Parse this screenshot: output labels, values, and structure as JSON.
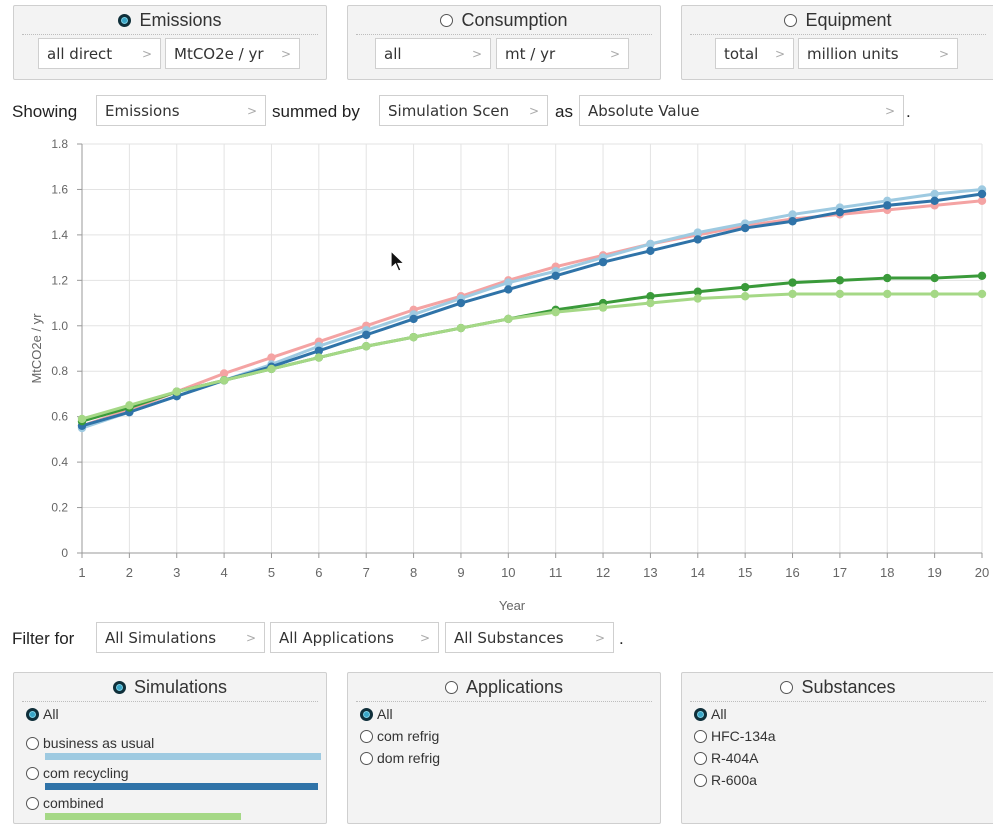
{
  "top_panels": [
    {
      "label": "Emissions",
      "selected": true,
      "dropdowns": [
        "all direct",
        "MtCO2e / yr"
      ]
    },
    {
      "label": "Consumption",
      "selected": false,
      "dropdowns": [
        "all",
        "mt / yr"
      ]
    },
    {
      "label": "Equipment",
      "selected": false,
      "dropdowns": [
        "total",
        "million units"
      ]
    }
  ],
  "showing": {
    "prefix": "Showing",
    "metric": "Emissions",
    "summed_by_label": "summed by",
    "group": "Simulation Scen",
    "as_label": "as",
    "mode": "Absolute Value",
    "period": "."
  },
  "filter": {
    "prefix": "Filter for",
    "simulations": "All Simulations",
    "applications": "All Applications",
    "substances": "All Substances",
    "period": "."
  },
  "bottom_panels": {
    "simulations": {
      "title": "Simulations",
      "selected": true,
      "items": [
        {
          "label": "All",
          "selected": true
        },
        {
          "label": "business as usual",
          "selected": false,
          "color": "#9ecae1",
          "bar_fraction": 1.0
        },
        {
          "label": "com recycling",
          "selected": false,
          "color": "#2f73a8",
          "bar_fraction": 0.99
        },
        {
          "label": "combined",
          "selected": false,
          "color": "#a5d886",
          "bar_fraction": 0.71
        }
      ]
    },
    "applications": {
      "title": "Applications",
      "selected": false,
      "items": [
        {
          "label": "All",
          "selected": true
        },
        {
          "label": "com refrig",
          "selected": false
        },
        {
          "label": "dom refrig",
          "selected": false
        }
      ]
    },
    "substances": {
      "title": "Substances",
      "selected": false,
      "items": [
        {
          "label": "All",
          "selected": true
        },
        {
          "label": "HFC-134a",
          "selected": false
        },
        {
          "label": "R-404A",
          "selected": false
        },
        {
          "label": "R-600a",
          "selected": false
        }
      ]
    }
  },
  "chart_data": {
    "type": "line",
    "xlabel": "Year",
    "ylabel": "MtCO2e / yr",
    "x": [
      1,
      2,
      3,
      4,
      5,
      6,
      7,
      8,
      9,
      10,
      11,
      12,
      13,
      14,
      15,
      16,
      17,
      18,
      19,
      20
    ],
    "xlim": [
      1,
      20
    ],
    "ylim": [
      0,
      1.8
    ],
    "yticks": [
      "0",
      "0.2",
      "0.4",
      "0.6",
      "0.8",
      "1.0",
      "1.2",
      "1.4",
      "1.6",
      "1.8"
    ],
    "grid": true,
    "series": [
      {
        "color": "#f4a3a3",
        "values": [
          0.56,
          0.63,
          0.71,
          0.79,
          0.86,
          0.93,
          1.0,
          1.07,
          1.13,
          1.2,
          1.26,
          1.31,
          1.36,
          1.4,
          1.44,
          1.47,
          1.49,
          1.51,
          1.53,
          1.55
        ]
      },
      {
        "color": "#9ecae1",
        "values": [
          0.55,
          0.62,
          0.69,
          0.76,
          0.83,
          0.91,
          0.98,
          1.05,
          1.12,
          1.19,
          1.24,
          1.3,
          1.36,
          1.41,
          1.45,
          1.49,
          1.52,
          1.55,
          1.58,
          1.6
        ]
      },
      {
        "color": "#2f73a8",
        "values": [
          0.56,
          0.62,
          0.69,
          0.76,
          0.82,
          0.89,
          0.96,
          1.03,
          1.1,
          1.16,
          1.22,
          1.28,
          1.33,
          1.38,
          1.43,
          1.46,
          1.5,
          1.53,
          1.55,
          1.58
        ]
      },
      {
        "color": "#3a9a3a",
        "values": [
          0.58,
          0.64,
          0.71,
          0.76,
          0.81,
          0.86,
          0.91,
          0.95,
          0.99,
          1.03,
          1.07,
          1.1,
          1.13,
          1.15,
          1.17,
          1.19,
          1.2,
          1.21,
          1.21,
          1.22
        ]
      },
      {
        "color": "#a5d886",
        "values": [
          0.59,
          0.65,
          0.71,
          0.76,
          0.81,
          0.86,
          0.91,
          0.95,
          0.99,
          1.03,
          1.06,
          1.08,
          1.1,
          1.12,
          1.13,
          1.14,
          1.14,
          1.14,
          1.14,
          1.14
        ]
      }
    ]
  }
}
